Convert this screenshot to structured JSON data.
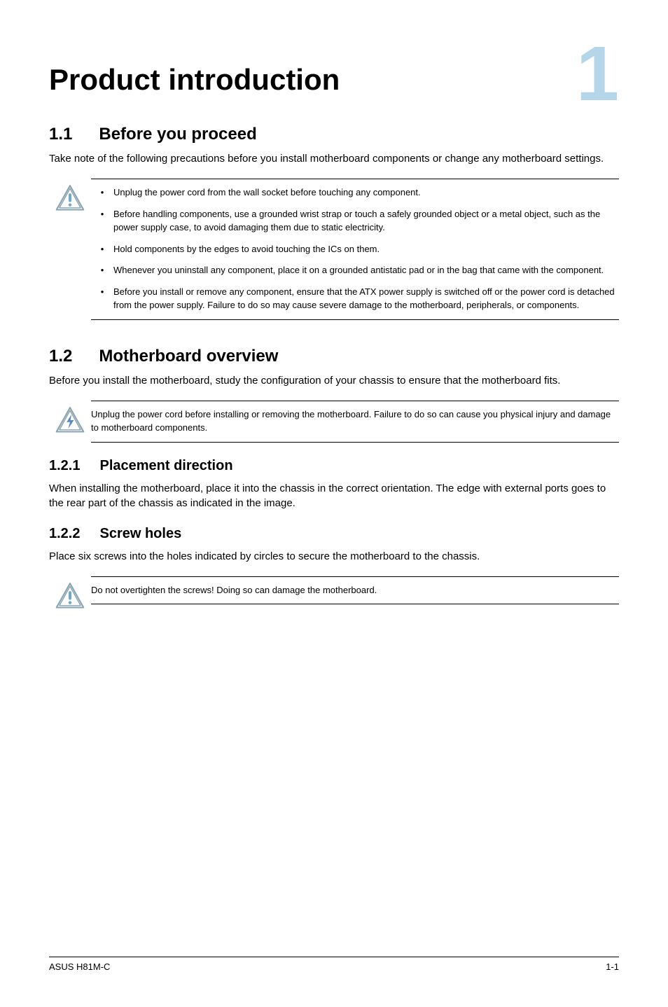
{
  "chapter": {
    "title": "Product introduction",
    "number": "1"
  },
  "sections": {
    "s11": {
      "number": "1.1",
      "title": "Before you proceed",
      "body": "Take note of the following precautions before you install motherboard components or change any motherboard settings."
    },
    "s12": {
      "number": "1.2",
      "title": "Motherboard overview",
      "body": "Before you install the motherboard, study the configuration of your chassis to ensure that the motherboard fits."
    }
  },
  "precautions": [
    "Unplug the power cord from the wall socket before touching any component.",
    "Before handling components, use a grounded wrist strap or touch a safely grounded object or a metal object, such as the power supply case, to avoid damaging them due to static electricity.",
    "Hold components by the edges to avoid touching the ICs on them.",
    "Whenever you uninstall any component, place it on a grounded antistatic pad or in the bag that came with the component.",
    "Before you install or remove any component, ensure that the ATX power supply is switched off or the power cord is detached from the power supply. Failure to do so may cause severe damage to the motherboard, peripherals, or components."
  ],
  "shock_note": "Unplug the power cord before installing or removing the motherboard. Failure to do so can cause you physical injury and damage to motherboard components.",
  "subsections": {
    "s121": {
      "number": "1.2.1",
      "title": "Placement direction",
      "body": "When installing the motherboard, place it into the chassis in the correct orientation. The edge with external ports goes to the rear part of the chassis as indicated in the image."
    },
    "s122": {
      "number": "1.2.2",
      "title": "Screw holes",
      "body": "Place six screws into the holes indicated by circles to secure the motherboard to the chassis."
    }
  },
  "overtighten_note": "Do not overtighten the screws! Doing so can damage the motherboard.",
  "footer": {
    "left": "ASUS H81M-C",
    "right": "1-1"
  },
  "icons": {
    "warning": "warning-triangle-icon",
    "shock": "shock-triangle-icon"
  },
  "colors": {
    "chapter_number": "#b5d6e8",
    "warning_stroke": "#89a3b0",
    "warning_dot": "#6fa8c9",
    "shock_stroke": "#89a3b0",
    "shock_fill": "#5a8bbd"
  }
}
